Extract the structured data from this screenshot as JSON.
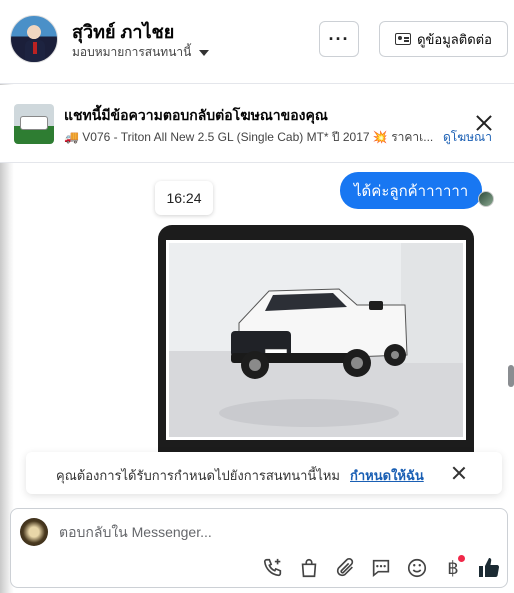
{
  "header": {
    "name": "สุวิทย์ ภาไชย",
    "subtitle": "มอบหมายการสนทนานี้",
    "more_label": "···",
    "contact_label": "ดูข้อมูลติดต่อ"
  },
  "banner": {
    "title": "แชทนี้มีข้อความตอบกลับต่อโฆษณาของคุณ",
    "description": "🚚 V076 - Triton All New 2.5 GL (Single Cab) MT* ปี 2017 💥 ราคาเ...",
    "link": "ดูโฆษณา"
  },
  "chat": {
    "timestamp": "16:24",
    "outgoing_message": "ได้ค่ะลูกค้าาาาาา"
  },
  "reminder": {
    "text": "คุณต้องการได้รับการกำหนดไปยังการสนทนานี้ไหม",
    "action": "กำหนดให้ฉัน"
  },
  "composer": {
    "placeholder": "ตอบกลับใน Messenger..."
  },
  "icons": {
    "call": "phone-add-icon",
    "shop": "shopping-bag-icon",
    "attach": "paperclip-icon",
    "quick_reply": "chat-bubble-icon",
    "emoji": "smiley-icon",
    "payment": "baht-icon",
    "like": "thumbs-up-icon"
  },
  "colors": {
    "accent": "#1877f2",
    "link": "#1a5fb4",
    "notification_dot": "#f02849"
  }
}
